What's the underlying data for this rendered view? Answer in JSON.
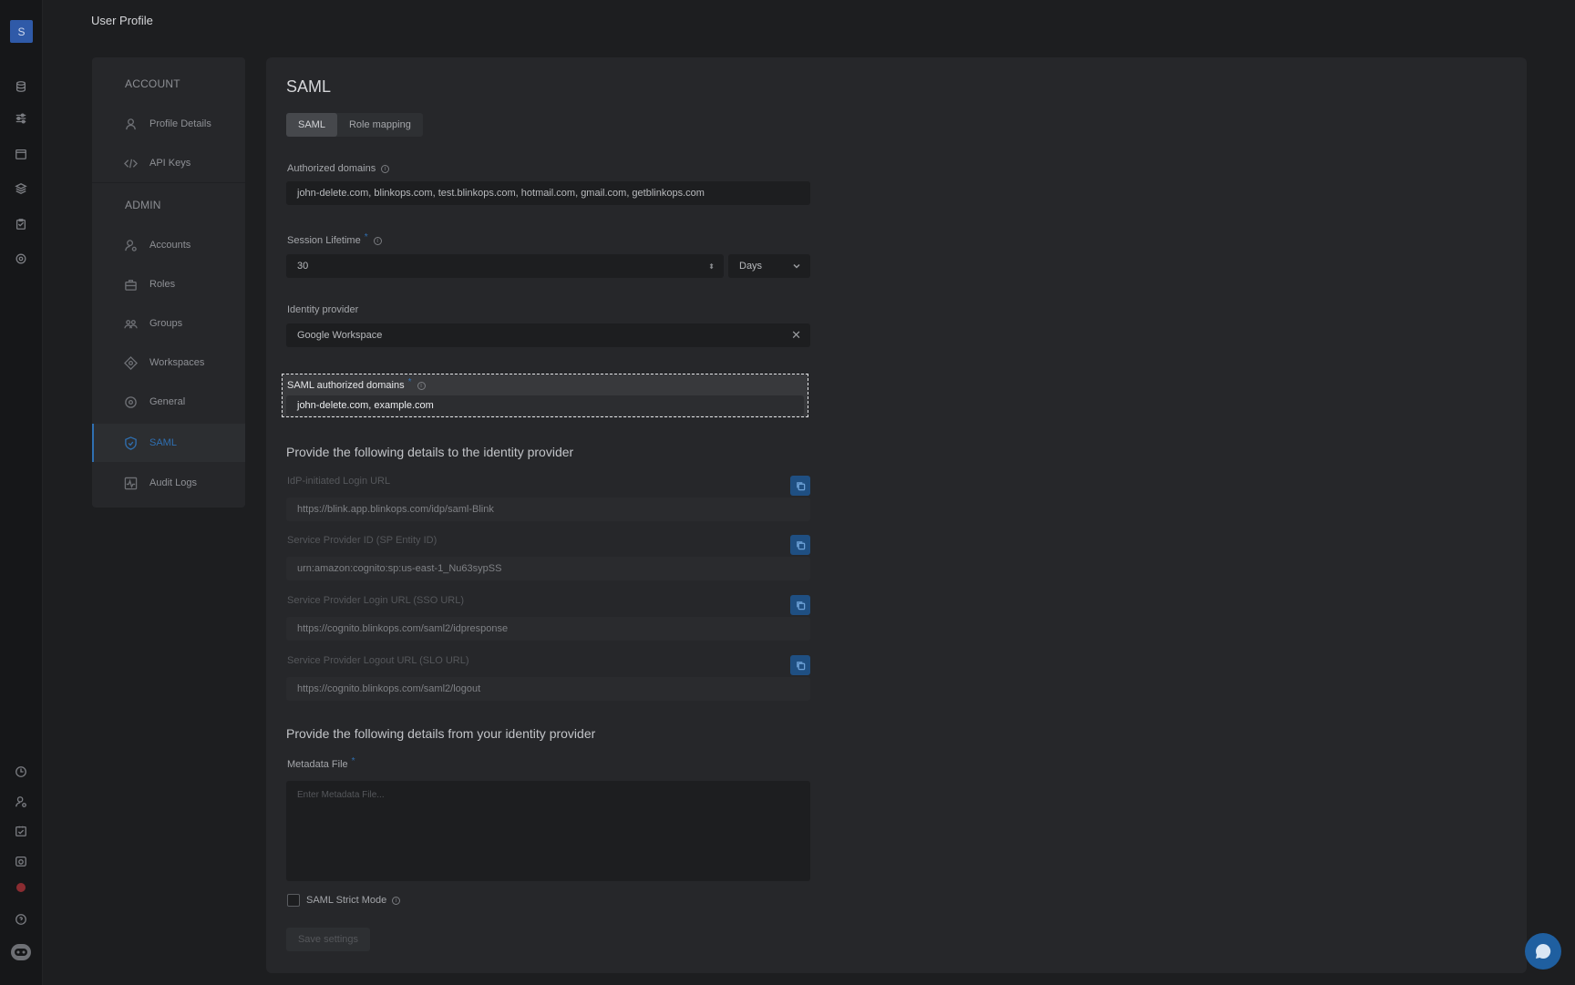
{
  "user": {
    "avatar_initial": "S"
  },
  "header": {
    "title": "User Profile"
  },
  "rail": {
    "top_icons": [
      "database-icon",
      "sliders-icon",
      "calendar-icon",
      "layers-icon",
      "clipboard-icon",
      "settings-icon"
    ],
    "bottom_icons": [
      "clock-icon",
      "user-settings-icon",
      "calendar-check-icon",
      "report-icon",
      "notification-icon",
      "help-icon",
      "bot-icon"
    ]
  },
  "nav": {
    "account_title": "ACCOUNT",
    "admin_title": "ADMIN",
    "account_items": [
      {
        "label": "Profile Details",
        "icon": "user-icon"
      },
      {
        "label": "API Keys",
        "icon": "code-icon"
      }
    ],
    "admin_items": [
      {
        "label": "Accounts",
        "icon": "users-icon"
      },
      {
        "label": "Roles",
        "icon": "briefcase-icon"
      },
      {
        "label": "Groups",
        "icon": "group-icon"
      },
      {
        "label": "Workspaces",
        "icon": "diamond-icon"
      },
      {
        "label": "General",
        "icon": "gear-icon"
      },
      {
        "label": "SAML",
        "icon": "shield-icon",
        "active": true
      },
      {
        "label": "Audit Logs",
        "icon": "activity-icon"
      }
    ],
    "accent_color": "#2f6fb1"
  },
  "main": {
    "title": "SAML",
    "tabs": [
      {
        "label": "SAML",
        "active": true
      },
      {
        "label": "Role mapping",
        "active": false
      }
    ],
    "authorized_domains": {
      "label": "Authorized domains",
      "value": "john-delete.com, blinkops.com, test.blinkops.com, hotmail.com, gmail.com, getblinkops.com"
    },
    "session_lifetime": {
      "label": "Session Lifetime",
      "value": "30",
      "unit": "Days"
    },
    "identity_provider": {
      "label": "Identity provider",
      "value": "Google Workspace"
    },
    "saml_authorized_domains": {
      "label": "SAML authorized domains",
      "value": "john-delete.com, example.com"
    },
    "provide_to_title": "Provide the following details to the identity provider",
    "provider_fields": [
      {
        "label": "IdP-initiated Login URL",
        "value": "https://blink.app.blinkops.com/idp/saml-Blink"
      },
      {
        "label": "Service Provider ID (SP Entity ID)",
        "value": "urn:amazon:cognito:sp:us-east-1_Nu63sypSS"
      },
      {
        "label": "Service Provider Login URL (SSO URL)",
        "value": "https://cognito.blinkops.com/saml2/idpresponse"
      },
      {
        "label": "Service Provider Logout URL (SLO URL)",
        "value": "https://cognito.blinkops.com/saml2/logout"
      }
    ],
    "provide_from_title": "Provide the following details from your identity provider",
    "metadata_file": {
      "label": "Metadata File",
      "placeholder": "Enter Metadata File..."
    },
    "strict_mode_label": "SAML Strict Mode",
    "save_label": "Save settings"
  }
}
